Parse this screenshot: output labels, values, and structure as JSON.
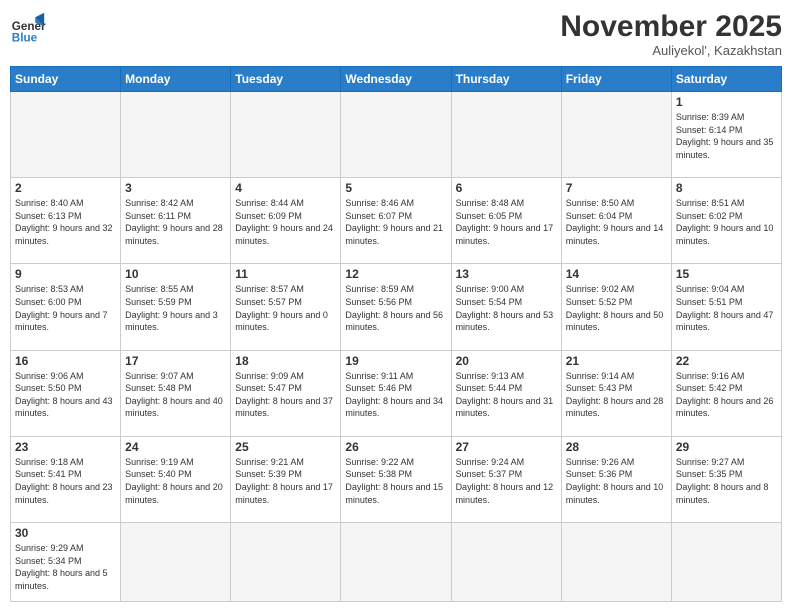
{
  "header": {
    "logo_general": "General",
    "logo_blue": "Blue",
    "month_title": "November 2025",
    "location": "Auliyekol', Kazakhstan"
  },
  "weekdays": [
    "Sunday",
    "Monday",
    "Tuesday",
    "Wednesday",
    "Thursday",
    "Friday",
    "Saturday"
  ],
  "weeks": [
    [
      {
        "day": "",
        "info": ""
      },
      {
        "day": "",
        "info": ""
      },
      {
        "day": "",
        "info": ""
      },
      {
        "day": "",
        "info": ""
      },
      {
        "day": "",
        "info": ""
      },
      {
        "day": "",
        "info": ""
      },
      {
        "day": "1",
        "info": "Sunrise: 8:39 AM\nSunset: 6:14 PM\nDaylight: 9 hours and 35 minutes."
      }
    ],
    [
      {
        "day": "2",
        "info": "Sunrise: 8:40 AM\nSunset: 6:13 PM\nDaylight: 9 hours and 32 minutes."
      },
      {
        "day": "3",
        "info": "Sunrise: 8:42 AM\nSunset: 6:11 PM\nDaylight: 9 hours and 28 minutes."
      },
      {
        "day": "4",
        "info": "Sunrise: 8:44 AM\nSunset: 6:09 PM\nDaylight: 9 hours and 24 minutes."
      },
      {
        "day": "5",
        "info": "Sunrise: 8:46 AM\nSunset: 6:07 PM\nDaylight: 9 hours and 21 minutes."
      },
      {
        "day": "6",
        "info": "Sunrise: 8:48 AM\nSunset: 6:05 PM\nDaylight: 9 hours and 17 minutes."
      },
      {
        "day": "7",
        "info": "Sunrise: 8:50 AM\nSunset: 6:04 PM\nDaylight: 9 hours and 14 minutes."
      },
      {
        "day": "8",
        "info": "Sunrise: 8:51 AM\nSunset: 6:02 PM\nDaylight: 9 hours and 10 minutes."
      }
    ],
    [
      {
        "day": "9",
        "info": "Sunrise: 8:53 AM\nSunset: 6:00 PM\nDaylight: 9 hours and 7 minutes."
      },
      {
        "day": "10",
        "info": "Sunrise: 8:55 AM\nSunset: 5:59 PM\nDaylight: 9 hours and 3 minutes."
      },
      {
        "day": "11",
        "info": "Sunrise: 8:57 AM\nSunset: 5:57 PM\nDaylight: 9 hours and 0 minutes."
      },
      {
        "day": "12",
        "info": "Sunrise: 8:59 AM\nSunset: 5:56 PM\nDaylight: 8 hours and 56 minutes."
      },
      {
        "day": "13",
        "info": "Sunrise: 9:00 AM\nSunset: 5:54 PM\nDaylight: 8 hours and 53 minutes."
      },
      {
        "day": "14",
        "info": "Sunrise: 9:02 AM\nSunset: 5:52 PM\nDaylight: 8 hours and 50 minutes."
      },
      {
        "day": "15",
        "info": "Sunrise: 9:04 AM\nSunset: 5:51 PM\nDaylight: 8 hours and 47 minutes."
      }
    ],
    [
      {
        "day": "16",
        "info": "Sunrise: 9:06 AM\nSunset: 5:50 PM\nDaylight: 8 hours and 43 minutes."
      },
      {
        "day": "17",
        "info": "Sunrise: 9:07 AM\nSunset: 5:48 PM\nDaylight: 8 hours and 40 minutes."
      },
      {
        "day": "18",
        "info": "Sunrise: 9:09 AM\nSunset: 5:47 PM\nDaylight: 8 hours and 37 minutes."
      },
      {
        "day": "19",
        "info": "Sunrise: 9:11 AM\nSunset: 5:46 PM\nDaylight: 8 hours and 34 minutes."
      },
      {
        "day": "20",
        "info": "Sunrise: 9:13 AM\nSunset: 5:44 PM\nDaylight: 8 hours and 31 minutes."
      },
      {
        "day": "21",
        "info": "Sunrise: 9:14 AM\nSunset: 5:43 PM\nDaylight: 8 hours and 28 minutes."
      },
      {
        "day": "22",
        "info": "Sunrise: 9:16 AM\nSunset: 5:42 PM\nDaylight: 8 hours and 26 minutes."
      }
    ],
    [
      {
        "day": "23",
        "info": "Sunrise: 9:18 AM\nSunset: 5:41 PM\nDaylight: 8 hours and 23 minutes."
      },
      {
        "day": "24",
        "info": "Sunrise: 9:19 AM\nSunset: 5:40 PM\nDaylight: 8 hours and 20 minutes."
      },
      {
        "day": "25",
        "info": "Sunrise: 9:21 AM\nSunset: 5:39 PM\nDaylight: 8 hours and 17 minutes."
      },
      {
        "day": "26",
        "info": "Sunrise: 9:22 AM\nSunset: 5:38 PM\nDaylight: 8 hours and 15 minutes."
      },
      {
        "day": "27",
        "info": "Sunrise: 9:24 AM\nSunset: 5:37 PM\nDaylight: 8 hours and 12 minutes."
      },
      {
        "day": "28",
        "info": "Sunrise: 9:26 AM\nSunset: 5:36 PM\nDaylight: 8 hours and 10 minutes."
      },
      {
        "day": "29",
        "info": "Sunrise: 9:27 AM\nSunset: 5:35 PM\nDaylight: 8 hours and 8 minutes."
      }
    ],
    [
      {
        "day": "30",
        "info": "Sunrise: 9:29 AM\nSunset: 5:34 PM\nDaylight: 8 hours and 5 minutes."
      },
      {
        "day": "",
        "info": ""
      },
      {
        "day": "",
        "info": ""
      },
      {
        "day": "",
        "info": ""
      },
      {
        "day": "",
        "info": ""
      },
      {
        "day": "",
        "info": ""
      },
      {
        "day": "",
        "info": ""
      }
    ]
  ]
}
